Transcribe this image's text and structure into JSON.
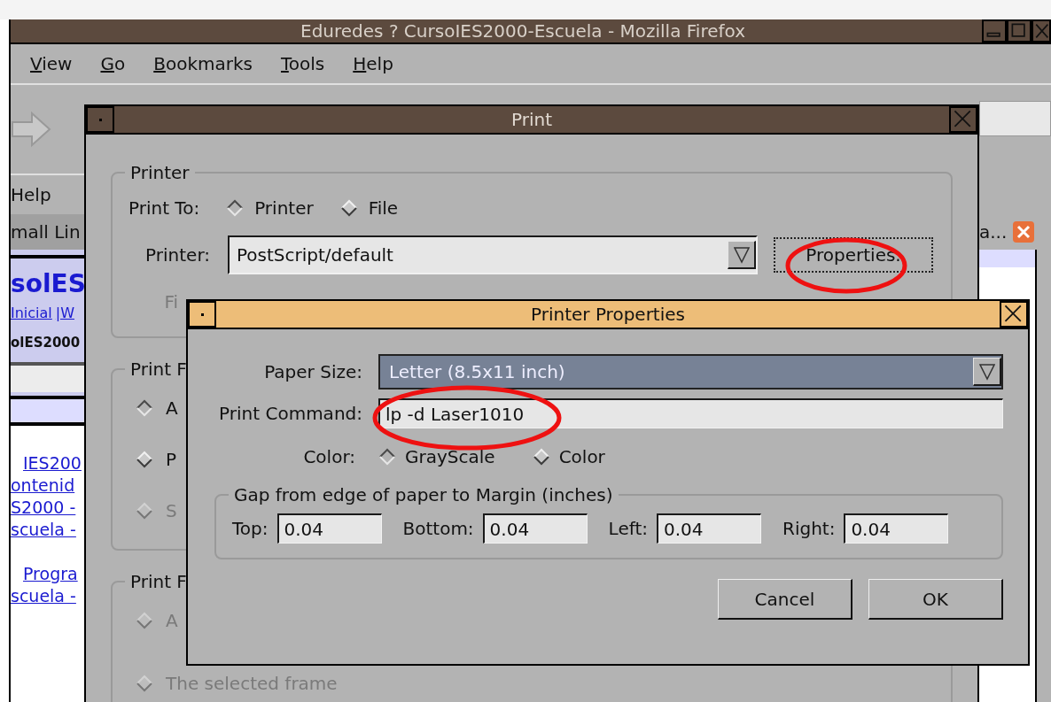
{
  "browser": {
    "title": "Eduredes ? CursoIES2000-Escuela - Mozilla Firefox",
    "menu": [
      "View",
      "Go",
      "Bookmarks",
      "Tools",
      "Help"
    ],
    "toolbar_text": "Help",
    "tab_left": "mall Lin",
    "tab_right": "a...",
    "page_heading": "solES",
    "page_nav": [
      "Inicial",
      "|W"
    ],
    "page_subheading": "olES2000",
    "page_links": [
      "IES200",
      "ontenid",
      "S2000 -",
      "scuela -",
      "Progra",
      "scuela -"
    ]
  },
  "print_dialog": {
    "title": "Print",
    "printer_group": {
      "legend": "Printer",
      "print_to_label": "Print To:",
      "print_to": [
        {
          "label": "Printer",
          "selected": true
        },
        {
          "label": "File",
          "selected": false
        }
      ],
      "printer_label": "Printer:",
      "printer_value": "PostScript/default",
      "properties_button": "Properties.",
      "file_label": "Fi"
    },
    "range_group": {
      "legend": "Print F",
      "options": [
        {
          "label": "A",
          "selected": true,
          "disabled": false
        },
        {
          "label": "P",
          "selected": false,
          "disabled": false
        },
        {
          "label": "S",
          "selected": false,
          "disabled": true
        }
      ]
    },
    "frames_group": {
      "legend": "Print F",
      "options": [
        {
          "label": "A",
          "selected": false,
          "disabled": true
        },
        {
          "label": "The selected frame",
          "selected": false,
          "disabled": true
        }
      ]
    }
  },
  "properties_dialog": {
    "title": "Printer Properties",
    "paper_size_label": "Paper Size:",
    "paper_size": "Letter (8.5x11 inch)",
    "print_command_label": "Print Command:",
    "print_command": "lp -d Laser1010",
    "color_label": "Color:",
    "color_options": [
      {
        "label": "GrayScale",
        "selected": true
      },
      {
        "label": "Color",
        "selected": false
      }
    ],
    "gap_group": {
      "legend": "Gap from edge of paper to Margin (inches)",
      "fields": [
        {
          "label": "Top:",
          "value": "0.04"
        },
        {
          "label": "Bottom:",
          "value": "0.04"
        },
        {
          "label": "Left:",
          "value": "0.04"
        },
        {
          "label": "Right:",
          "value": "0.04"
        }
      ]
    },
    "buttons": [
      "Cancel",
      "OK"
    ]
  }
}
